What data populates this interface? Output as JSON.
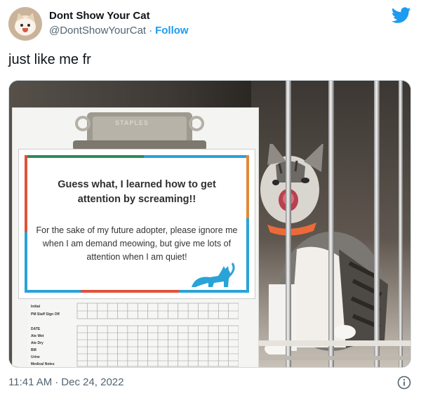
{
  "tweet": {
    "author_name": "Dont Show Your Cat",
    "handle": "@DontShowYourCat",
    "separator": "·",
    "follow_label": "Follow",
    "text": "just like me fr",
    "time": "11:41 AM",
    "date": "Dec 24, 2022"
  },
  "image": {
    "clip_brand": "STAPLES",
    "sign_title": "Guess what, I learned how to get attention by screaming!!",
    "sign_body": "For the sake of my future adopter, please ignore me when I am demand meowing, but give me lots of attention when I am quiet!",
    "chart_labels": [
      "Initial",
      "PM Staff Sign Off",
      "DATE",
      "Ate Wet",
      "Ate Dry",
      "BM",
      "Urine",
      "Medical Notes"
    ]
  },
  "colors": {
    "twitter_blue": "#1d9bf0",
    "text_primary": "#0f1419",
    "text_secondary": "#536471"
  },
  "icons": {
    "brand": "twitter-bird-icon",
    "info": "info-circle-icon"
  }
}
